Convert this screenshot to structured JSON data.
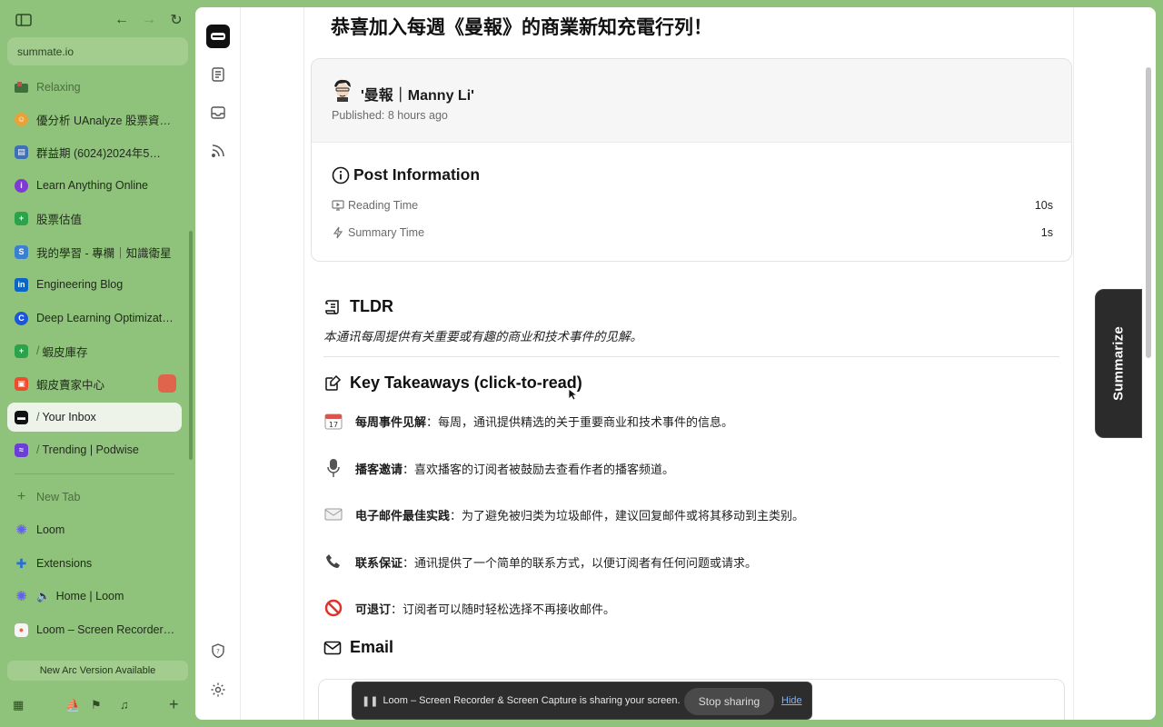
{
  "sidebar": {
    "url": "summate.io",
    "tabs": [
      {
        "label": "Relaxing",
        "icon": "folder-flag-icon",
        "color": "#c0504d"
      },
      {
        "label": "優分析 UAnalyze 股票資…",
        "icon": "uanalyze-favicon-icon",
        "color": "#e7a33a"
      },
      {
        "label": "群益期 (6024)2024年5…",
        "icon": "document-favicon-icon",
        "color": "#3f6fb5"
      },
      {
        "label": "Learn Anything Online",
        "icon": "learn-favicon-icon",
        "color": "#7d3bd1"
      },
      {
        "label": "股票估值",
        "icon": "plus-sheet-favicon-icon",
        "color": "#2aa34a"
      },
      {
        "label": "我的學習 - 專欄｜知識衛星",
        "icon": "knowledge-favicon-icon",
        "color": "#3b7fd0"
      },
      {
        "label": "Engineering Blog",
        "icon": "linkedin-icon",
        "color": "#0a66c2"
      },
      {
        "label": "Deep Learning Optimizat…",
        "icon": "coursera-icon",
        "color": "#1a56db"
      },
      {
        "label": "蝦皮庫存",
        "icon": "plus-sheet-favicon-icon",
        "color": "#2aa34a"
      },
      {
        "label": "蝦皮賣家中心",
        "icon": "shopee-icon",
        "color": "#ee4d2d"
      },
      {
        "label": "Your Inbox",
        "icon": "summate-favicon-icon",
        "color": "#111111"
      },
      {
        "label": "Trending | Podwise",
        "icon": "podwise-favicon-icon",
        "color": "#6b3fd6"
      }
    ],
    "new_tab": "New Tab",
    "pinned": [
      {
        "label": "Loom",
        "icon": "loom-icon"
      },
      {
        "label": "Extensions",
        "icon": "puzzle-icon"
      },
      {
        "label": "Home | Loom",
        "icon": "loom-icon"
      },
      {
        "label": "Loom – Screen Recorder…",
        "icon": "loom-recorder-icon"
      }
    ],
    "update_banner": "New Arc Version Available",
    "accent": "#8fc27a"
  },
  "article": {
    "title": "恭喜加入每週《曼報》的商業新知充電行列！",
    "author": "'曼報｜Manny Li'",
    "published": "Published: 8 hours ago",
    "info_title": "Post Information",
    "reading_time_label": "Reading Time",
    "reading_time_value": "10s",
    "summary_time_label": "Summary Time",
    "summary_time_value": "1s",
    "tldr_title": "TLDR",
    "tldr_text": "本通讯每周提供有关重要或有趣的商业和技术事件的见解。",
    "takeaways_title": "Key Takeaways (click-to-read)",
    "takeaways": [
      {
        "emoji": "calendar-emoji-icon",
        "title": "每周事件见解",
        "text": "：每周，通讯提供精选的关于重要商业和技术事件的信息。"
      },
      {
        "emoji": "microphone-emoji-icon",
        "title": "播客邀请",
        "text": "：喜欢播客的订阅者被鼓励去查看作者的播客频道。"
      },
      {
        "emoji": "envelope-emoji-icon",
        "title": "电子邮件最佳实践",
        "text": "：为了避免被归类为垃圾邮件，建议回复邮件或将其移动到主类别。"
      },
      {
        "emoji": "telephone-emoji-icon",
        "title": "联系保证",
        "text": "：通讯提供了一个简单的联系方式，以便订阅者有任何问题或请求。"
      },
      {
        "emoji": "no-entry-emoji-icon",
        "title": "可退订",
        "text": "：订阅者可以随时轻松选择不再接收邮件。"
      }
    ],
    "email_title": "Email"
  },
  "summarize_button": "Summarize",
  "share_bar": {
    "message": "Loom – Screen Recorder & Screen Capture is sharing your screen.",
    "stop_label": "Stop sharing",
    "hide_label": "Hide"
  }
}
